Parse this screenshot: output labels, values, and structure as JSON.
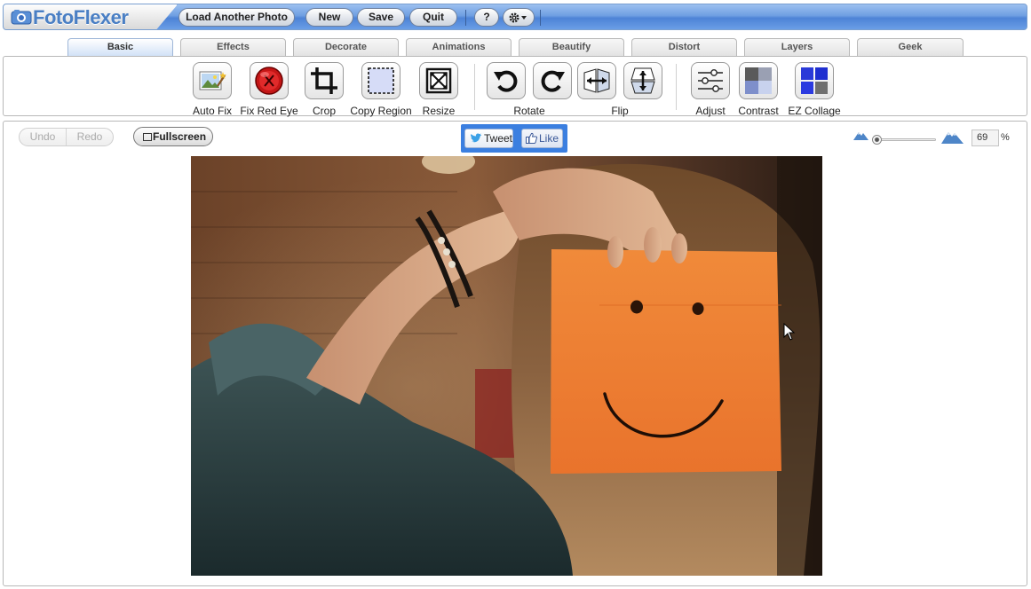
{
  "app": {
    "title": "FotoFlexer"
  },
  "toolbar": {
    "load_label": "Load Another Photo",
    "new_label": "New",
    "save_label": "Save",
    "quit_label": "Quit",
    "help_label": "?",
    "settings_icon": "gear-icon"
  },
  "tabs": [
    {
      "label": "Basic",
      "active": true
    },
    {
      "label": "Effects"
    },
    {
      "label": "Decorate"
    },
    {
      "label": "Animations"
    },
    {
      "label": "Beautify"
    },
    {
      "label": "Distort"
    },
    {
      "label": "Layers"
    },
    {
      "label": "Geek"
    }
  ],
  "tools": {
    "auto_fix": "Auto Fix",
    "fix_red_eye": "Fix Red Eye",
    "crop": "Crop",
    "copy_region": "Copy Region",
    "resize": "Resize",
    "rotate": "Rotate",
    "flip": "Flip",
    "adjust": "Adjust",
    "contrast": "Contrast",
    "ez_collage": "EZ Collage"
  },
  "workspace": {
    "undo_label": "Undo",
    "redo_label": "Redo",
    "fullscreen_label": "Fullscreen",
    "tweet_label": "Tweet",
    "like_label": "Like",
    "zoom_value": "69",
    "zoom_unit": "%",
    "zoom_slider_level": 0.05
  },
  "colors": {
    "accent_blue": "#4d83d6",
    "social_bg": "#3b7fe0",
    "napkin_orange": "#ee7a2f"
  }
}
